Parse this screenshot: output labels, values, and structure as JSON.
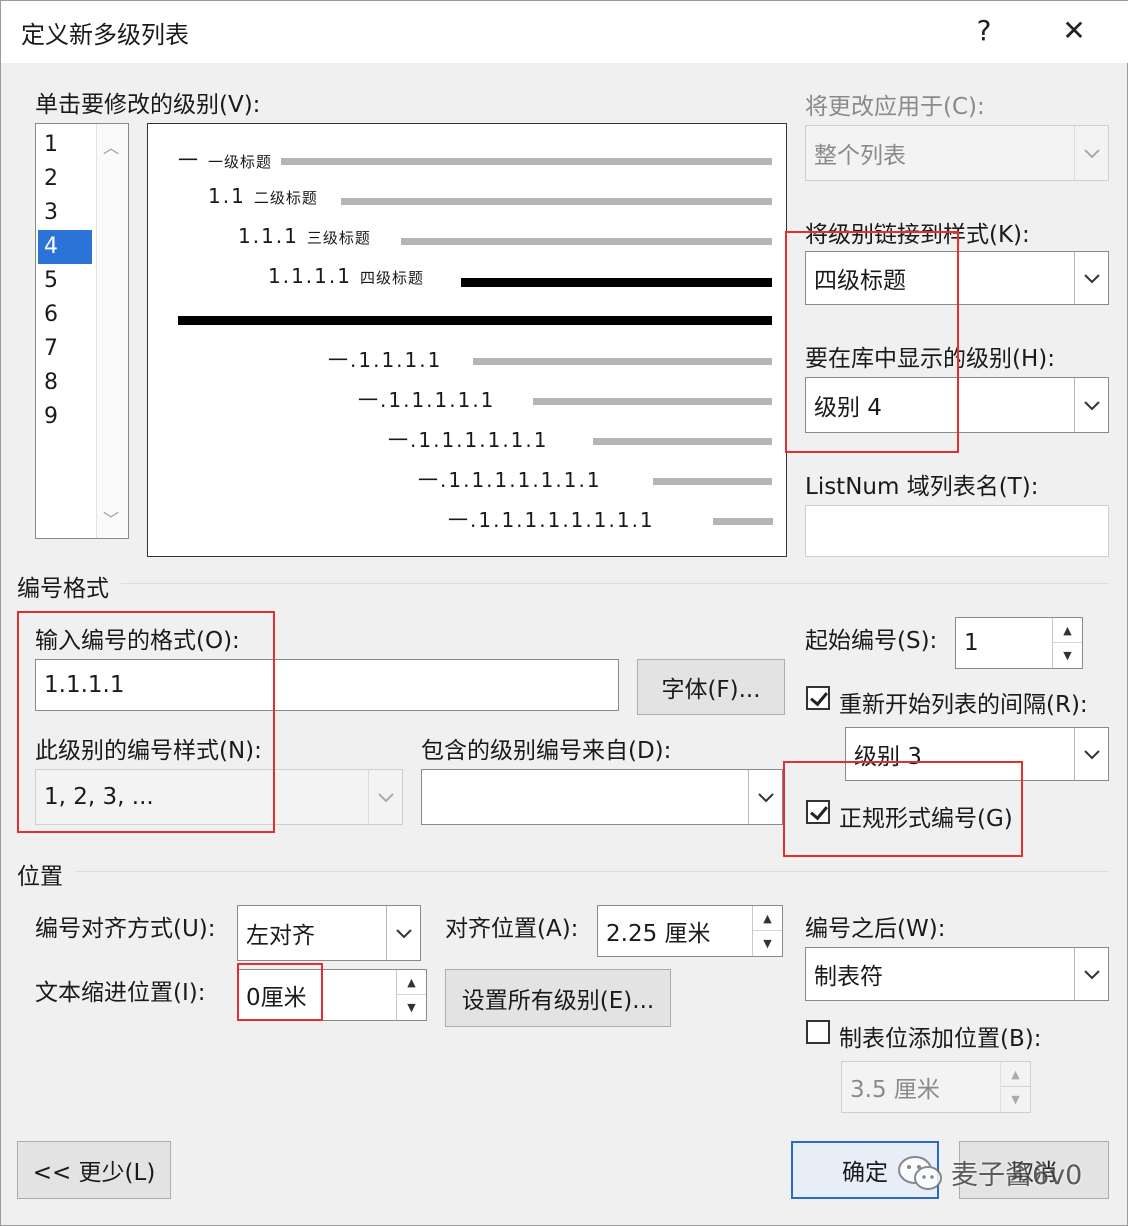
{
  "dialog": {
    "title": "定义新多级列表",
    "help_glyph": "?",
    "close_glyph": "✕"
  },
  "levels": {
    "label": "单击要修改的级别(V):",
    "items": [
      "1",
      "2",
      "3",
      "4",
      "5",
      "6",
      "7",
      "8",
      "9"
    ],
    "selected_index": 3
  },
  "preview": {
    "rows": [
      {
        "prefix": "一",
        "caption": "一级标题",
        "bold": false
      },
      {
        "prefix": "1.1",
        "caption": "二级标题",
        "bold": false
      },
      {
        "prefix": "1.1.1",
        "caption": "三级标题",
        "bold": false
      },
      {
        "prefix": "1.1.1.1",
        "caption": "四级标题",
        "bold": true
      },
      {
        "prefix": "",
        "caption": "",
        "bold": true
      },
      {
        "prefix": "一.1.1.1.1",
        "caption": "",
        "bold": false
      },
      {
        "prefix": "一.1.1.1.1.1",
        "caption": "",
        "bold": false
      },
      {
        "prefix": "一.1.1.1.1.1.1",
        "caption": "",
        "bold": false
      },
      {
        "prefix": "一.1.1.1.1.1.1.1",
        "caption": "",
        "bold": false
      },
      {
        "prefix": "一.1.1.1.1.1.1.1.1",
        "caption": "",
        "bold": false
      }
    ]
  },
  "apply_to": {
    "label": "将更改应用于(C):",
    "value": "整个列表"
  },
  "link_style": {
    "label": "将级别链接到样式(K):",
    "value": "四级标题"
  },
  "gallery_level": {
    "label": "要在库中显示的级别(H):",
    "value": "级别 4"
  },
  "listnum": {
    "label": "ListNum 域列表名(T):",
    "value": ""
  },
  "number_format_section": "编号格式",
  "format_input": {
    "label": "输入编号的格式(O):",
    "value": "1.1.1.1"
  },
  "font_button": "字体(F)...",
  "number_style": {
    "label": "此级别的编号样式(N):",
    "value": "1, 2, 3, ..."
  },
  "include_level": {
    "label": "包含的级别编号来自(D):",
    "value": ""
  },
  "start_at": {
    "label": "起始编号(S):",
    "value": "1"
  },
  "restart": {
    "label": "重新开始列表的间隔(R):",
    "checked": true,
    "value": "级别 3"
  },
  "legal": {
    "label": "正规形式编号(G)",
    "checked": true
  },
  "position_section": "位置",
  "alignment": {
    "label": "编号对齐方式(U):",
    "value": "左对齐"
  },
  "aligned_at": {
    "label": "对齐位置(A):",
    "value": "2.25 厘米"
  },
  "follow_with": {
    "label": "编号之后(W):",
    "value": "制表符"
  },
  "text_indent": {
    "label": "文本缩进位置(I):",
    "value": "0厘米"
  },
  "set_all_button": "设置所有级别(E)...",
  "tab_stop": {
    "label": "制表位添加位置(B):",
    "checked": false,
    "value": "3.5 厘米"
  },
  "less_button": "<< 更少(L)",
  "ok_button": "确定",
  "cancel_button": "取消",
  "watermark": "麦子酱6v0"
}
